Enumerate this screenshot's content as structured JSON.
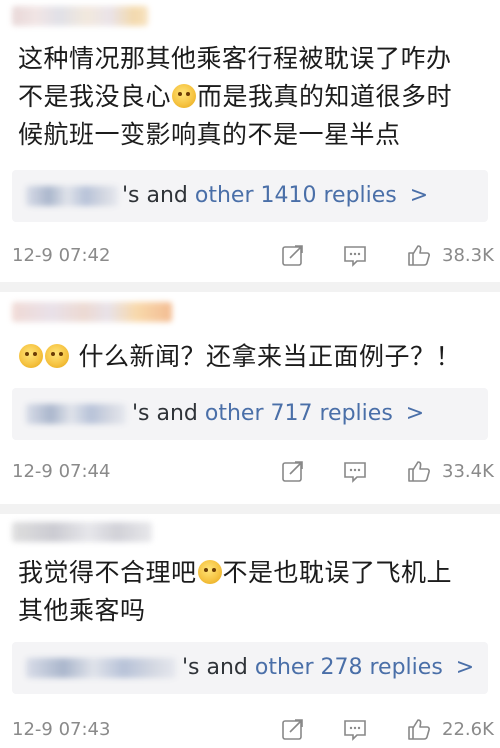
{
  "comments": [
    {
      "lines": [
        "这种情况那其他乘客行程被耽误了咋办",
        "不是我没良心",
        "而是我真的知道很多时",
        "候航班一变影响真的不是一星半点"
      ],
      "reply_suffix": "'s and",
      "reply_link": "other 1410 replies",
      "time": "12-9 07:42",
      "likes": "38.3K"
    },
    {
      "text": "什么新闻？还拿来当正面例子？！",
      "reply_suffix": "'s and",
      "reply_link": "other 717 replies",
      "time": "12-9 07:44",
      "likes": "33.4K"
    },
    {
      "lines": [
        "我觉得不合理吧",
        "不是也耽误了飞机上",
        "其他乘客吗"
      ],
      "reply_suffix": "'s and",
      "reply_link": "other 278 replies",
      "time": "12-9 07:43",
      "likes": "22.6K"
    }
  ],
  "chevron": ">",
  "icons": [
    "share-icon",
    "comment-icon",
    "like-icon"
  ],
  "colors": {
    "link": "#4a6fa8",
    "meta": "#8a8a8a",
    "divider": "#f2f2f2"
  }
}
